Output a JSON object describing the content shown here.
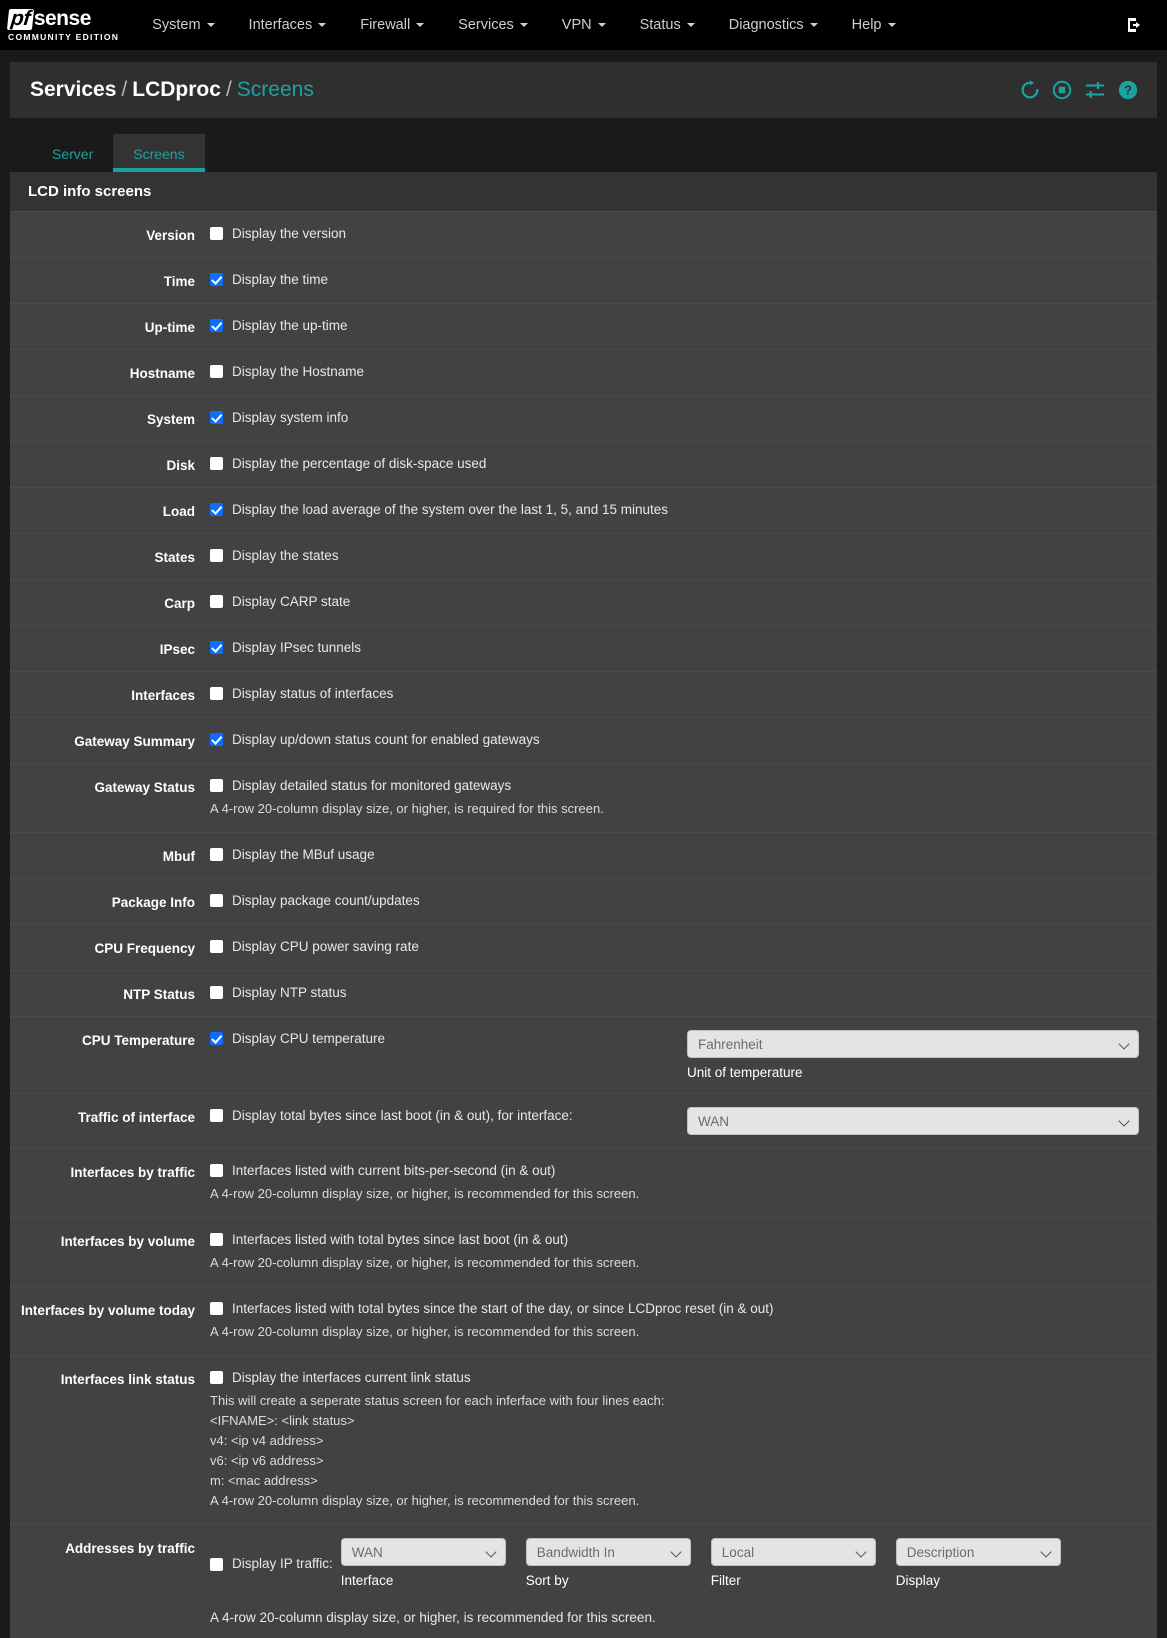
{
  "navbar": {
    "brand_main": "sense",
    "brand_pf": "pf",
    "brand_sub": "COMMUNITY EDITION",
    "items": [
      {
        "label": "System"
      },
      {
        "label": "Interfaces"
      },
      {
        "label": "Firewall"
      },
      {
        "label": "Services"
      },
      {
        "label": "VPN"
      },
      {
        "label": "Status"
      },
      {
        "label": "Diagnostics"
      },
      {
        "label": "Help"
      }
    ],
    "logout_icon": "logout-icon"
  },
  "breadcrumb": {
    "root": "Services",
    "section": "LCDproc",
    "current": "Screens",
    "separator": "/",
    "icons": [
      "restart-icon",
      "stop-icon",
      "sliders-icon",
      "help-icon"
    ]
  },
  "tabs": [
    {
      "label": "Server",
      "active": false
    },
    {
      "label": "Screens",
      "active": true
    }
  ],
  "panel": {
    "title": "LCD info screens"
  },
  "rows": [
    {
      "label": "Version",
      "checkbox_label": "Display the version",
      "checked": false
    },
    {
      "label": "Time",
      "checkbox_label": "Display the time",
      "checked": true
    },
    {
      "label": "Up-time",
      "checkbox_label": "Display the up-time",
      "checked": true
    },
    {
      "label": "Hostname",
      "checkbox_label": "Display the Hostname",
      "checked": false
    },
    {
      "label": "System",
      "checkbox_label": "Display system info",
      "checked": true
    },
    {
      "label": "Disk",
      "checkbox_label": "Display the percentage of disk-space used",
      "checked": false
    },
    {
      "label": "Load",
      "checkbox_label": "Display the load average of the system over the last 1, 5, and 15 minutes",
      "checked": true
    },
    {
      "label": "States",
      "checkbox_label": "Display the states",
      "checked": false
    },
    {
      "label": "Carp",
      "checkbox_label": "Display CARP state",
      "checked": false
    },
    {
      "label": "IPsec",
      "checkbox_label": "Display IPsec tunnels",
      "checked": true
    },
    {
      "label": "Interfaces",
      "checkbox_label": "Display status of interfaces",
      "checked": false
    },
    {
      "label": "Gateway Summary",
      "checkbox_label": "Display up/down status count for enabled gateways",
      "checked": true
    },
    {
      "label": "Gateway Status",
      "checkbox_label": "Display detailed status for monitored gateways",
      "checked": false,
      "help": "A 4-row 20-column display size, or higher, is required for this screen."
    },
    {
      "label": "Mbuf",
      "checkbox_label": "Display the MBuf usage",
      "checked": false
    },
    {
      "label": "Package Info",
      "checkbox_label": "Display package count/updates",
      "checked": false
    },
    {
      "label": "CPU Frequency",
      "checkbox_label": "Display CPU power saving rate",
      "checked": false
    },
    {
      "label": "NTP Status",
      "checkbox_label": "Display NTP status",
      "checked": false
    }
  ],
  "cpu_temperature": {
    "label": "CPU Temperature",
    "checkbox_label": "Display CPU temperature",
    "checked": true,
    "select_value": "Fahrenheit",
    "select_caption": "Unit of temperature"
  },
  "traffic_of_interface": {
    "label": "Traffic of interface",
    "checkbox_label": "Display total bytes since last boot (in & out), for interface:",
    "checked": false,
    "select_value": "WAN"
  },
  "interfaces_by_traffic": {
    "label": "Interfaces by traffic",
    "checkbox_label": "Interfaces listed with current bits-per-second (in & out)",
    "checked": false,
    "help": "A 4-row 20-column display size, or higher, is recommended for this screen."
  },
  "interfaces_by_volume": {
    "label": "Interfaces by volume",
    "checkbox_label": "Interfaces listed with total bytes since last boot (in & out)",
    "checked": false,
    "help": "A 4-row 20-column display size, or higher, is recommended for this screen."
  },
  "interfaces_by_volume_today": {
    "label": "Interfaces by volume today",
    "checkbox_label": "Interfaces listed with total bytes since the start of the day, or since LCDproc reset (in & out)",
    "checked": false,
    "help": "A 4-row 20-column display size, or higher, is recommended for this screen."
  },
  "interfaces_link_status": {
    "label": "Interfaces link status",
    "checkbox_label": "Display the interfaces current link status",
    "checked": false,
    "help_line1": "This will create a seperate status screen for each inferface with four lines each:",
    "help_line2": "<IFNAME>: <link status>",
    "help_line3": "v4: <ip v4 address>",
    "help_line4": "v6: <ip v6 address>",
    "help_line5": "m: <mac address>",
    "help_line6": "A 4-row 20-column display size, or higher, is recommended for this screen."
  },
  "addresses_by_traffic": {
    "label": "Addresses by traffic",
    "checkbox_label": "Display IP traffic:",
    "checked": false,
    "selects": [
      {
        "value": "WAN",
        "caption": "Interface"
      },
      {
        "value": "Bandwidth In",
        "caption": "Sort by"
      },
      {
        "value": "Local",
        "caption": "Filter"
      },
      {
        "value": "Description",
        "caption": "Display"
      }
    ],
    "help": "A 4-row 20-column display size, or higher, is recommended for this screen."
  },
  "colors": {
    "accent": "#1ba3a0",
    "checkbox_on": "#0d6efd",
    "navbar_bg": "#000000",
    "row_bg": "#424242",
    "panel_head_bg": "#333333"
  }
}
